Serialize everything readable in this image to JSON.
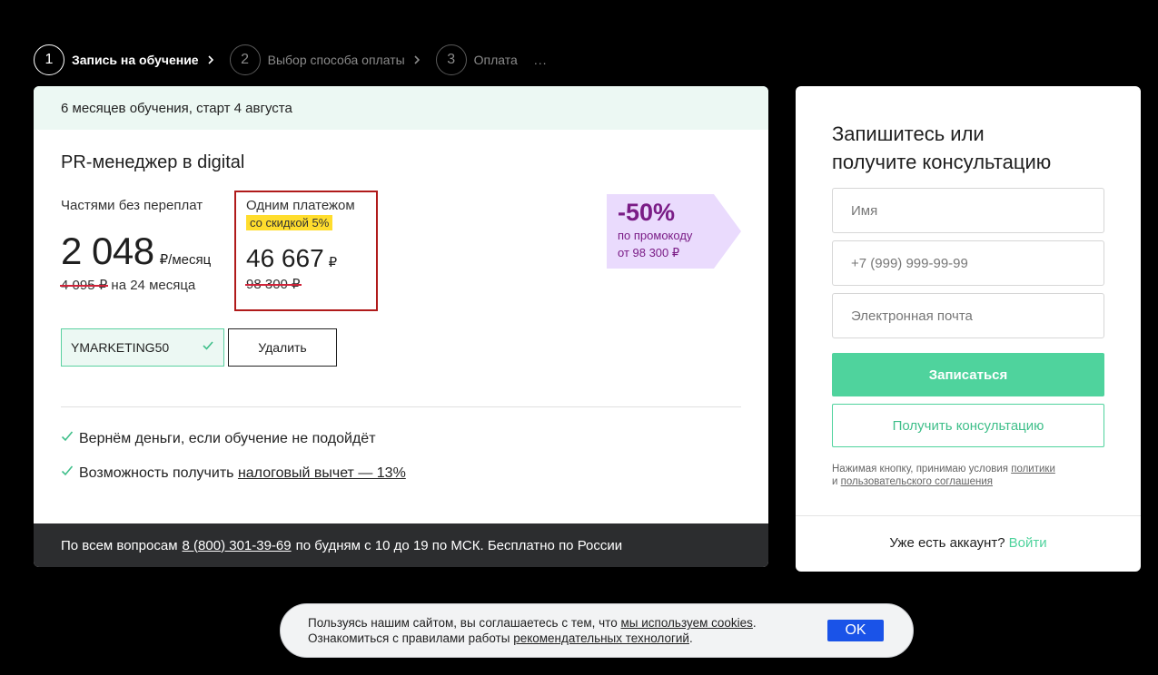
{
  "stepper": {
    "steps": [
      {
        "num": "1",
        "label": "Запись на обучение"
      },
      {
        "num": "2",
        "label": "Выбор способа оплаты"
      },
      {
        "num": "3",
        "label": "Оплата"
      }
    ],
    "more": "..."
  },
  "course": {
    "duration_text": "6 месяцев обучения, старт 4 августа",
    "title": "PR-менеджер в digital"
  },
  "price_parts": {
    "label": "Частями без переплат",
    "amount": "2 048",
    "unit": "₽/месяц",
    "old_amount": "4 095 ₽",
    "period": "на 24 месяца"
  },
  "price_once": {
    "label": "Одним платежом",
    "discount_badge": "со скидкой 5%",
    "amount": "46 667",
    "currency": "₽",
    "old_amount": "98 300 ₽"
  },
  "promo_flag": {
    "percent": "-50%",
    "line1": "по промокоду",
    "line2": "от 98 300 ₽"
  },
  "promo_code": {
    "value": "YMARKETING50",
    "delete_label": "Удалить"
  },
  "benefits": {
    "refund": "Вернём деньги, если обучение не подойдёт",
    "tax_prefix": "Возможность получить",
    "tax_link": "налоговый вычет — 13%"
  },
  "footer": {
    "prefix": "По всем вопросам",
    "phone": "8 (800) 301-39-69",
    "suffix": "по будням с 10 до 19 по МСК. Бесплатно по России"
  },
  "form": {
    "title_line1": "Запишитесь или",
    "title_line2": "получите консультацию",
    "name_placeholder": "Имя",
    "phone_placeholder": "+7 (999) 999-99-99",
    "email_placeholder": "Электронная почта",
    "submit_label": "Записаться",
    "consult_label": "Получить консультацию",
    "terms_prefix": "Нажимая кнопку, принимаю условия",
    "terms_link1": "политики",
    "terms_and": "и",
    "terms_link2": "пользовательского соглашения",
    "login_prefix": "Уже есть аккаунт?",
    "login_link": "Войти"
  },
  "cookie": {
    "line1_prefix": "Пользуясь нашим сайтом, вы соглашаетесь с тем, что",
    "line1_link": "мы используем cookies",
    "line2_prefix": "Ознакомиться с правилами работы",
    "line2_link": "рекомендательных технологий",
    "ok_label": "OK"
  },
  "colors": {
    "accent_green": "#4fd39d",
    "promo_purple": "#7a1c86",
    "promo_bg": "#eadbfd",
    "badge_yellow": "#ffdd2d",
    "cookie_ok_blue": "#1a53e8",
    "highlight_border": "#b01a1a"
  },
  "icons": {
    "step_chevron": "chevron-right-icon",
    "promo_check": "check-icon",
    "benefit_tick": "check-icon"
  }
}
